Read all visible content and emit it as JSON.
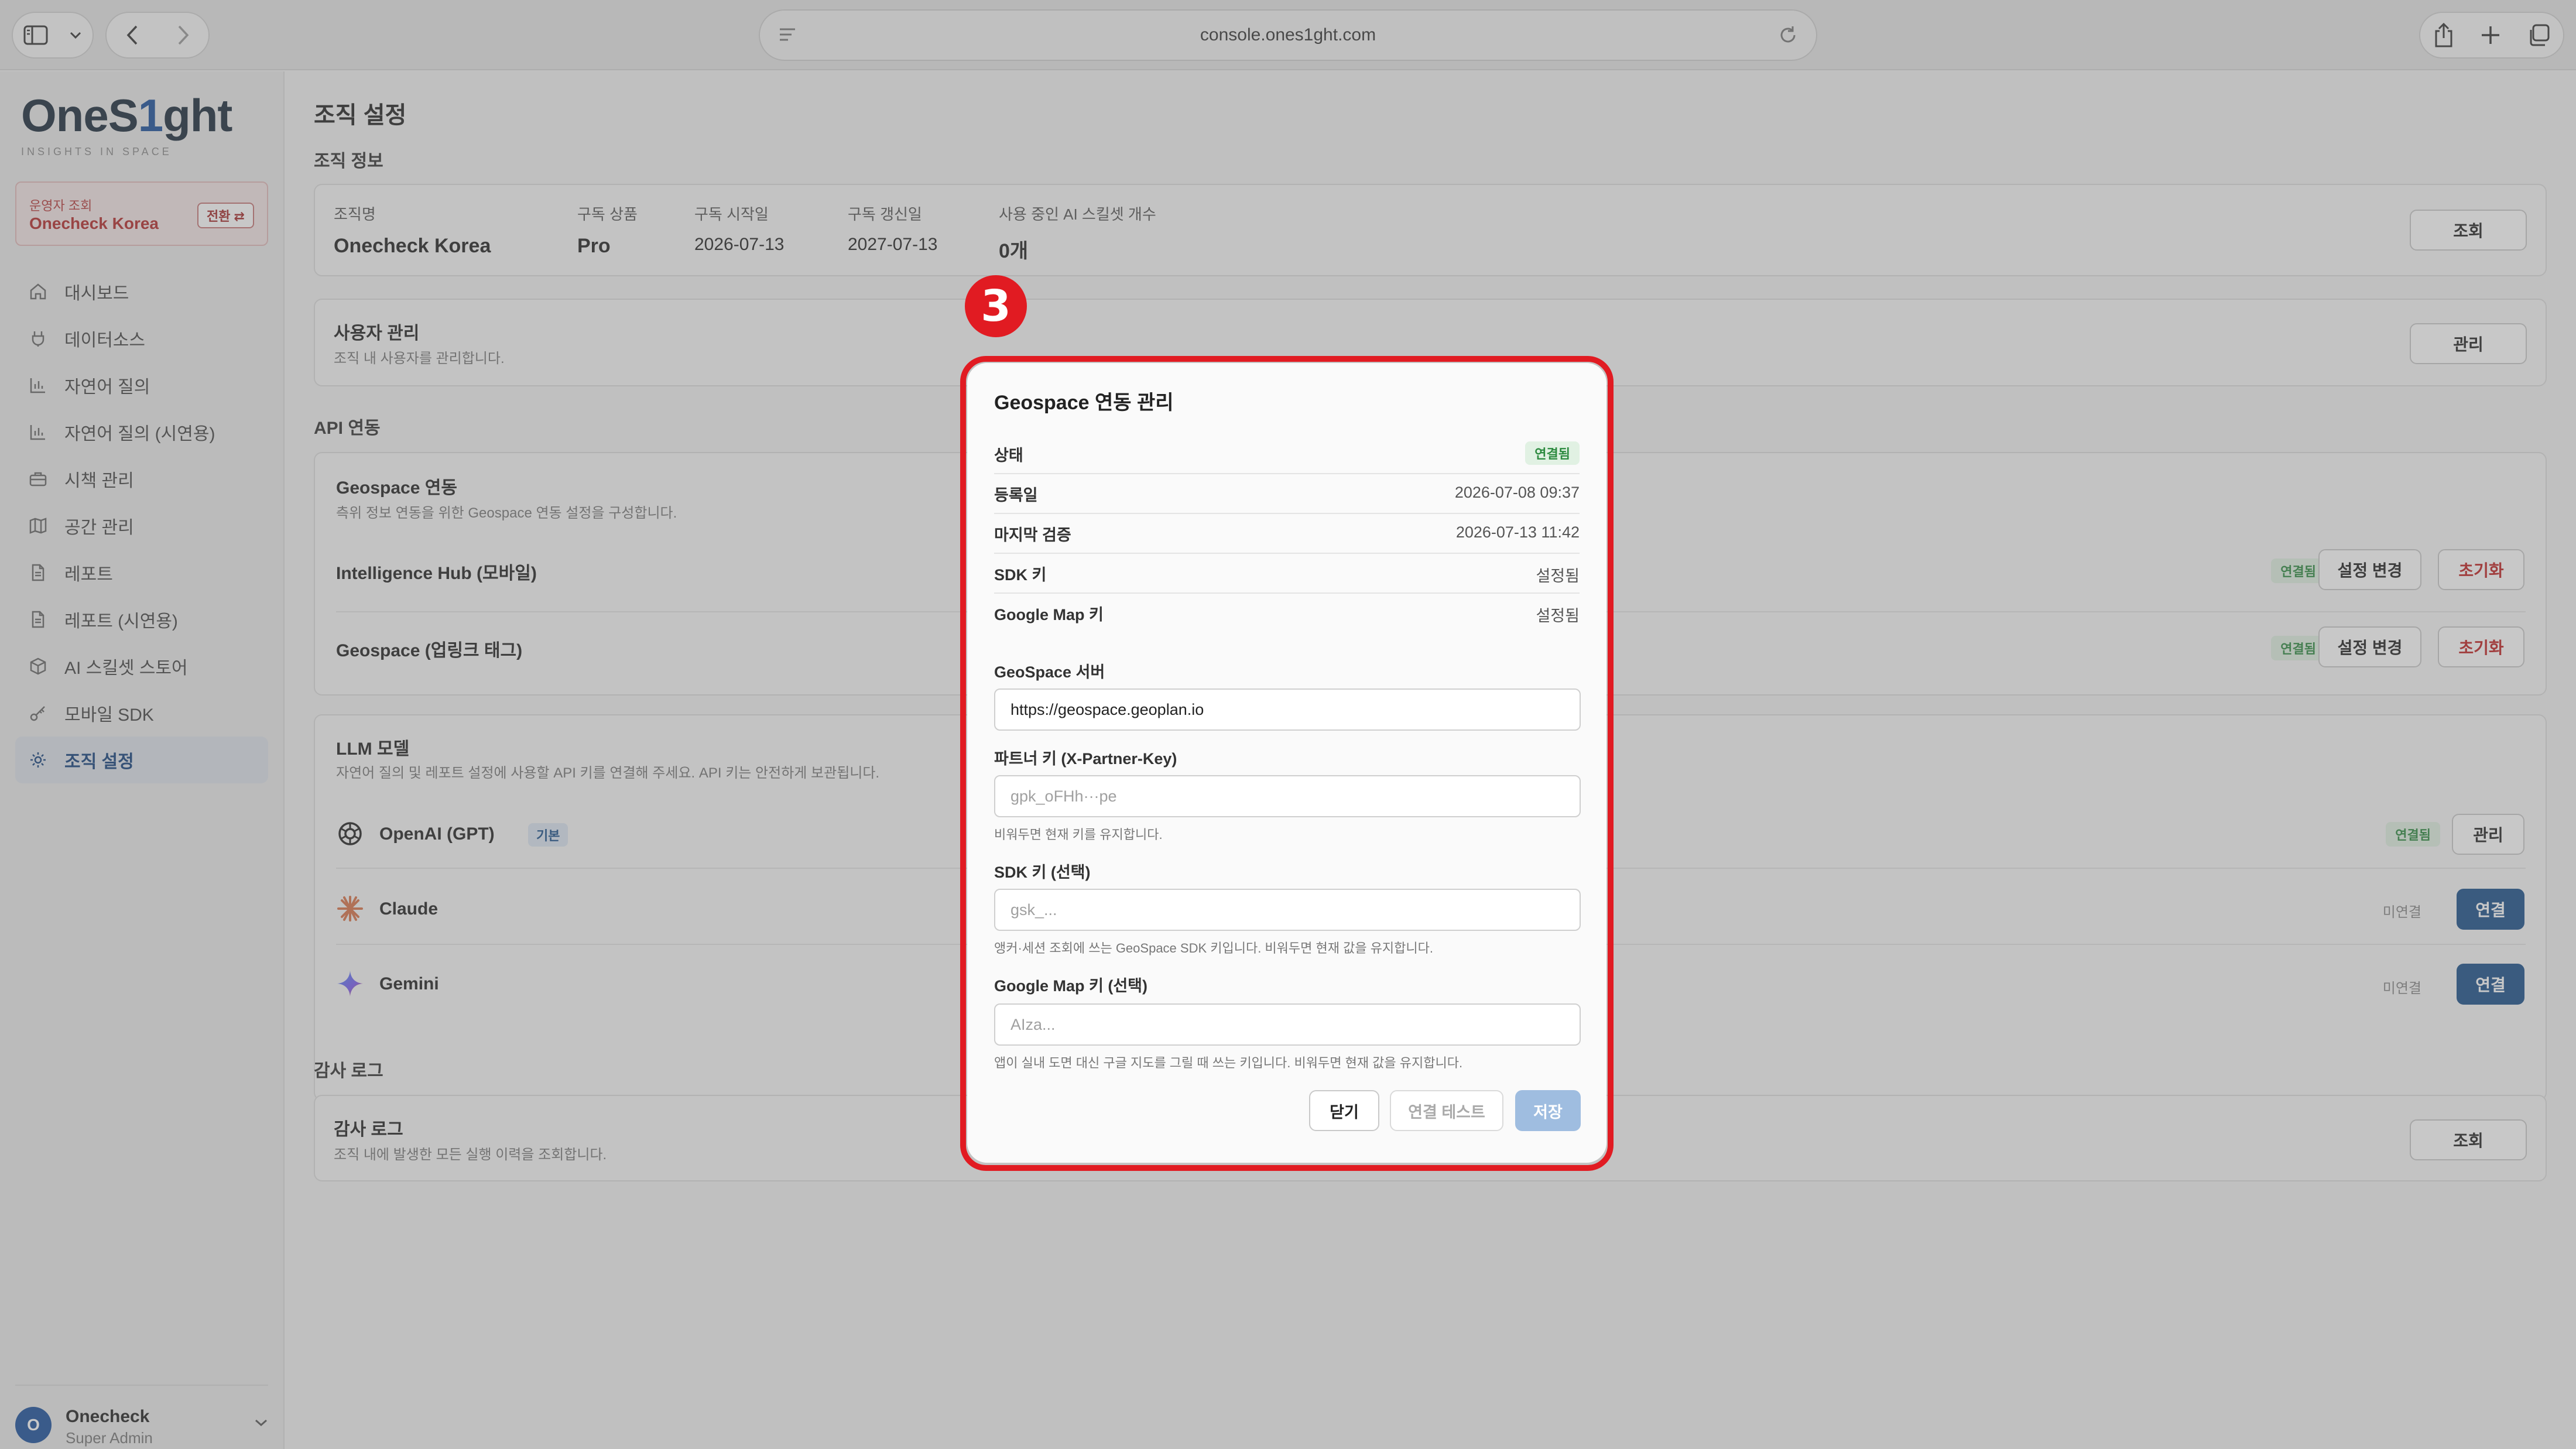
{
  "browser": {
    "url": "console.ones1ght.com"
  },
  "brand": {
    "name_a": "OneS",
    "name_b": "1",
    "name_c": "ght",
    "tagline": "INSIGHTS IN SPACE"
  },
  "operator": {
    "label": "운영자 조회",
    "org": "Onecheck Korea",
    "switch_label": "전환 ⇄"
  },
  "nav": {
    "items": [
      {
        "label": "대시보드",
        "icon": "home-icon"
      },
      {
        "label": "데이터소스",
        "icon": "plug-icon"
      },
      {
        "label": "자연어 질의",
        "icon": "bar-chart-icon"
      },
      {
        "label": "자연어 질의 (시연용)",
        "icon": "bar-chart-icon"
      },
      {
        "label": "시책 관리",
        "icon": "briefcase-icon"
      },
      {
        "label": "공간 관리",
        "icon": "map-icon"
      },
      {
        "label": "레포트",
        "icon": "document-icon"
      },
      {
        "label": "레포트 (시연용)",
        "icon": "document-icon"
      },
      {
        "label": "AI 스킬셋 스토어",
        "icon": "box-icon"
      },
      {
        "label": "모바일 SDK",
        "icon": "key-icon"
      },
      {
        "label": "조직 설정",
        "icon": "gear-icon"
      }
    ]
  },
  "user": {
    "initial": "O",
    "name": "Onecheck",
    "role": "Super Admin"
  },
  "page": {
    "title": "조직 설정"
  },
  "org_info": {
    "section_title": "조직 정보",
    "org_name_label": "조직명",
    "org_name": "Onecheck Korea",
    "plan_label": "구독 상품",
    "plan": "Pro",
    "start_label": "구독 시작일",
    "start": "2026-07-13",
    "renew_label": "구독 갱신일",
    "renew": "2027-07-13",
    "skills_label": "사용 중인 AI 스킬셋 개수",
    "skills": "0개",
    "view_button": "조회"
  },
  "user_mgmt": {
    "title": "사용자 관리",
    "subtitle": "조직 내 사용자를 관리합니다.",
    "button": "관리"
  },
  "api": {
    "section_title": "API 연동",
    "geo_title": "Geospace 연동",
    "geo_subtitle": "측위 정보 연동을 위한 Geospace 연동 설정을 구성합니다.",
    "rows": [
      {
        "name": "Intelligence Hub (모바일)",
        "status": "연결됨",
        "edit": "설정 변경",
        "reset": "초기화"
      },
      {
        "name": "Geospace (업링크 태그)",
        "status": "연결됨",
        "edit": "설정 변경",
        "reset": "초기화"
      }
    ]
  },
  "llm": {
    "title": "LLM 모델",
    "subtitle": "자연어 질의 및 레포트 설정에 사용할 API 키를 연결해 주세요. API 키는 안전하게 보관됩니다.",
    "models": [
      {
        "name": "OpenAI (GPT)",
        "tag": "기본",
        "status": "연결됨",
        "action": "관리"
      },
      {
        "name": "Claude",
        "status": "미연결",
        "action": "연결"
      },
      {
        "name": "Gemini",
        "status": "미연결",
        "action": "연결"
      }
    ]
  },
  "audit": {
    "section_title": "감사 로그",
    "title": "감사 로그",
    "subtitle": "조직 내에 발생한 모든 실행 이력을 조회합니다.",
    "button": "조회"
  },
  "step": {
    "number": "3"
  },
  "modal": {
    "title": "Geospace 연동 관리",
    "status_label": "상태",
    "status": "연결됨",
    "registered_label": "등록일",
    "registered": "2026-07-08 09:37",
    "verified_label": "마지막 검증",
    "verified": "2026-07-13 11:42",
    "sdk_label": "SDK 키",
    "sdk_value": "설정됨",
    "gmap_label": "Google Map 키",
    "gmap_value": "설정됨",
    "server_label": "GeoSpace 서버",
    "server_value": "https://geospace.geoplan.io",
    "partner_label": "파트너 키 (X-Partner-Key)",
    "partner_placeholder": "gpk_oFHh···pe",
    "partner_help": "비워두면 현재 키를 유지합니다.",
    "sdk_field_label": "SDK 키 (선택)",
    "sdk_placeholder": "gsk_...",
    "sdk_help": "앵커·세션 조회에 쓰는 GeoSpace SDK 키입니다. 비워두면 현재 값을 유지합니다.",
    "gmap_field_label": "Google Map 키 (선택)",
    "gmap_placeholder": "AIza...",
    "gmap_help": "앱이 실내 도면 대신 구글 지도를 그릴 때 쓰는 키입니다. 비워두면 현재 값을 유지합니다.",
    "close_button": "닫기",
    "test_button": "연결 테스트",
    "save_button": "저장"
  },
  "colors": {
    "accent": "#1b4f8a",
    "highlight": "#e11b22",
    "success": "#2c8a3f",
    "danger": "#c02323"
  }
}
